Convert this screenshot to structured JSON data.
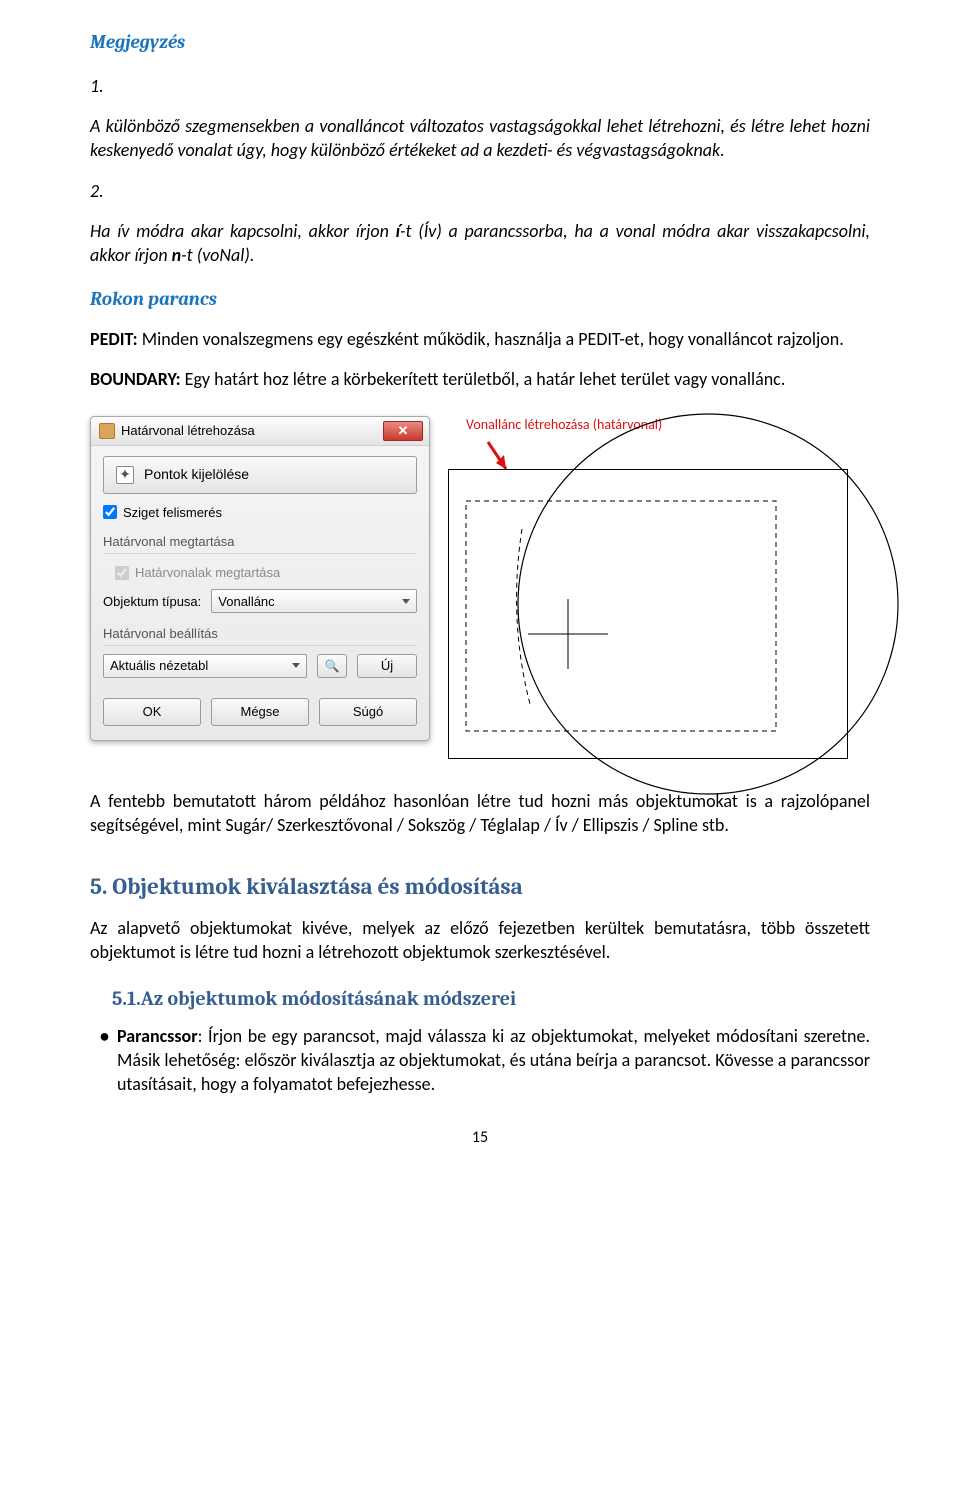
{
  "note_heading": "Megjegyzés",
  "note1_num": "1.",
  "note1_text": "A különböző szegmensekben a vonalláncot változatos vastagságokkal lehet létrehozni, és létre lehet hozni keskenyedő vonalat úgy, hogy különböző értékeket ad a  kezdeti-  és végvastagságoknak.",
  "note2_num": "2.",
  "note2_text_a": "Ha ív módra akar kapcsolni, akkor írjon ",
  "note2_bold1": "í",
  "note2_text_b": "-t (Ív) a parancssorba, ha a vonal módra akar visszakapcsolni, akkor írjon ",
  "note2_bold2": "n",
  "note2_text_c": "-t (voNal).",
  "rokon_heading": "Rokon parancs",
  "pedit_label": "PEDIT:",
  "pedit_text": " Minden vonalszegmens egy egészként működik, használja a PEDIT-et, hogy vonalláncot rajzoljon.",
  "boundary_label": "BOUNDARY:",
  "boundary_text": " Egy határt hoz létre a körbekerített területből, a határ lehet terület vagy vonallánc.",
  "annotation": "Vonallánc létrehozása (határvonal)",
  "dialog": {
    "title": "Határvonal létrehozása",
    "pick_points": "Pontok kijelölése",
    "island": "Sziget felismerés",
    "keep_group": "Határvonal megtartása",
    "keep_boundaries": "Határvonalak megtartása",
    "obj_type_label": "Objektum típusa:",
    "obj_type_value": "Vonallánc",
    "boundary_group": "Határvonal beállítás",
    "viewport_value": "Aktuális nézetabl",
    "new_btn": "Új",
    "ok": "OK",
    "cancel": "Mégse",
    "help": "Súgó"
  },
  "para_after": "A fentebb bemutatott három példához hasonlóan létre tud hozni más objektumokat is a rajzolópanel segítségével, mint Sugár/ Szerkesztővonal / Sokszög / Téglalap / Ív / Ellipszis / Spline  stb.",
  "section5_heading": "5.  Objektumok kiválasztása és módosítása",
  "section5_text": "Az alapvető objektumokat kivéve, melyek az előző fejezetben kerültek bemutatásra, több összetett objektumot is létre tud hozni a létrehozott objektumok szerkesztésével.",
  "section51_heading": "5.1.Az objektumok módosításának módszerei",
  "bullet_bold": "Parancssor",
  "bullet_text": ":  Írjon  be  egy  parancsot,  majd  válassza  ki  az  objektumokat,  melyeket módosítani szeretne. Másik lehetőség: először kiválasztja az objektumokat, és utána beírja a parancsot. Kövesse a parancssor utasításait, hogy a folyamatot befejezhesse.",
  "page_number": "15"
}
